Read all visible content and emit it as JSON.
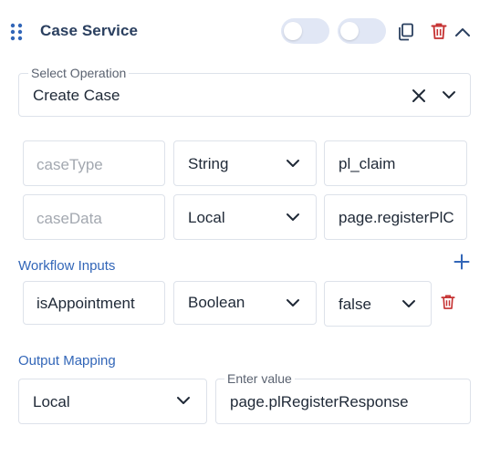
{
  "header": {
    "title": "Case Service",
    "drag_icon": "drag-handle-icon",
    "copy_icon": "copy-icon",
    "delete_icon": "trash-icon",
    "collapse_icon": "chevron-up-icon"
  },
  "operation": {
    "label": "Select Operation",
    "value": "Create Case"
  },
  "case_params": [
    {
      "name": "caseType",
      "type": "String",
      "value": "pl_claim"
    },
    {
      "name": "caseData",
      "type": "Local",
      "value": "page.registerPlC"
    }
  ],
  "workflow_inputs": {
    "label": "Workflow Inputs",
    "rows": [
      {
        "name": "isAppointment",
        "type": "Boolean",
        "value": "false"
      }
    ]
  },
  "output_mapping": {
    "label": "Output Mapping",
    "source": "Local",
    "value_label": "Enter value",
    "value": "page.plRegisterResponse"
  },
  "colors": {
    "title": "#2a3f5f",
    "accent_blue": "#3266b8",
    "delete_red": "#c53030",
    "toggle_bg": "#e1e7f5",
    "border": "#dde2ea"
  }
}
